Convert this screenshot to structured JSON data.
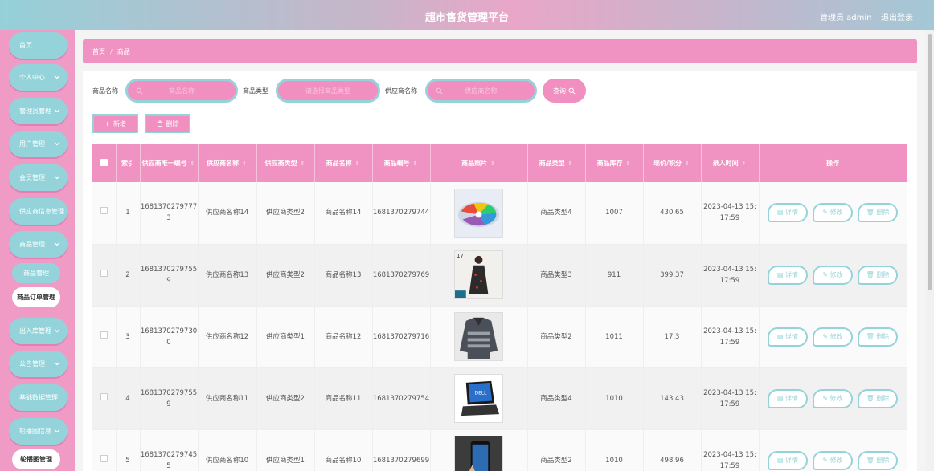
{
  "header": {
    "title": "超市售货管理平台",
    "user": "管理员 admin",
    "logout": "退出登录"
  },
  "sidebar": {
    "items": [
      {
        "label": "首页",
        "chevron": false
      },
      {
        "label": "个人中心",
        "chevron": true
      },
      {
        "label": "管理员管理",
        "chevron": true
      },
      {
        "label": "用户管理",
        "chevron": true
      },
      {
        "label": "会员管理",
        "chevron": true
      },
      {
        "label": "供应商信息管理",
        "chevron": true
      },
      {
        "label": "商品管理",
        "chevron": true
      },
      {
        "label": "出入库管理",
        "chevron": true
      },
      {
        "label": "公告管理",
        "chevron": true
      },
      {
        "label": "基础数据管理",
        "chevron": true
      },
      {
        "label": "轮播图信息",
        "chevron": true
      }
    ],
    "subitems": [
      {
        "label": "商品管理"
      },
      {
        "label": "商品订单管理"
      },
      {
        "label": "轮播图管理"
      }
    ]
  },
  "breadcrumb": {
    "home": "首页",
    "current": "商品"
  },
  "filters": {
    "name_label": "商品名称",
    "name_placeholder": "商品名称",
    "type_label": "商品类型",
    "type_placeholder": "请选择商品类型",
    "supplier_label": "供应商名称",
    "supplier_placeholder": "供应商名称",
    "search": "查询"
  },
  "actions": {
    "add": "新增",
    "delete": "删除"
  },
  "table": {
    "headers": [
      "索引",
      "供应商唯一编号",
      "供应商名称",
      "供应商类型",
      "商品名称",
      "商品编号",
      "商品照片",
      "商品类型",
      "商品库存",
      "现价/积分",
      "录入时间",
      "操作"
    ],
    "op_labels": {
      "detail": "详情",
      "edit": "修改",
      "delete": "删除"
    },
    "rows": [
      {
        "index": "1",
        "supplier_id": "16813702797773",
        "supplier_name": "供应商名称14",
        "supplier_type": "供应商类型2",
        "name": "商品名称14",
        "code": "1681370279744",
        "photo": "plates",
        "type": "商品类型4",
        "stock": "1007",
        "price": "430.65",
        "time": "2023-04-13 15:17:59"
      },
      {
        "index": "2",
        "supplier_id": "16813702797559",
        "supplier_name": "供应商名称13",
        "supplier_type": "供应商类型2",
        "name": "商品名称13",
        "code": "1681370279769",
        "photo": "dress",
        "type": "商品类型3",
        "stock": "911",
        "price": "399.37",
        "time": "2023-04-13 15:17:59"
      },
      {
        "index": "3",
        "supplier_id": "16813702797300",
        "supplier_name": "供应商名称12",
        "supplier_type": "供应商类型1",
        "name": "商品名称12",
        "code": "1681370279716",
        "photo": "sweater",
        "type": "商品类型2",
        "stock": "1011",
        "price": "17.3",
        "time": "2023-04-13 15:17:59"
      },
      {
        "index": "4",
        "supplier_id": "16813702797559",
        "supplier_name": "供应商名称11",
        "supplier_type": "供应商类型2",
        "name": "商品名称11",
        "code": "1681370279754",
        "photo": "laptop",
        "type": "商品类型4",
        "stock": "1010",
        "price": "143.43",
        "time": "2023-04-13 15:17:59"
      },
      {
        "index": "5",
        "supplier_id": "16813702797455",
        "supplier_name": "供应商名称10",
        "supplier_type": "供应商类型1",
        "name": "商品名称10",
        "code": "1681370279699",
        "photo": "phone",
        "type": "商品类型2",
        "stock": "1010",
        "price": "498.96",
        "time": "2023-04-13 15:17:59"
      }
    ]
  }
}
